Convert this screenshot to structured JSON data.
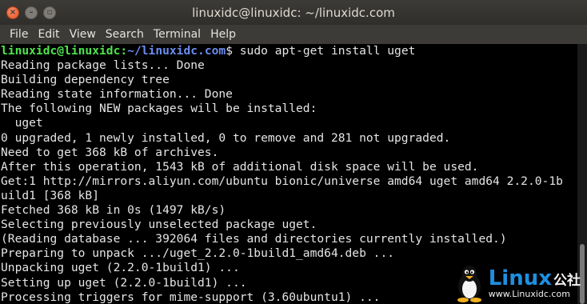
{
  "window": {
    "title": "linuxidc@linuxidc: ~/linuxidc.com",
    "close_glyph": "×",
    "min_glyph": "–",
    "max_glyph": "▫"
  },
  "menu": {
    "items": [
      "File",
      "Edit",
      "View",
      "Search",
      "Terminal",
      "Help"
    ]
  },
  "terminal": {
    "prompt_user": "linuxidc@linuxidc",
    "prompt_sep": ":",
    "prompt_path": "~/linuxidc.com",
    "prompt_end": "$ ",
    "command": "sudo apt-get install uget",
    "output": [
      "Reading package lists... Done",
      "Building dependency tree",
      "Reading state information... Done",
      "The following NEW packages will be installed:",
      "  uget",
      "0 upgraded, 1 newly installed, 0 to remove and 281 not upgraded.",
      "Need to get 368 kB of archives.",
      "After this operation, 1543 kB of additional disk space will be used.",
      "Get:1 http://mirrors.aliyun.com/ubuntu bionic/universe amd64 uget amd64 2.2.0-1b",
      "uild1 [368 kB]",
      "Fetched 368 kB in 0s (1497 kB/s)",
      "Selecting previously unselected package uget.",
      "(Reading database ... 392064 files and directories currently installed.)",
      "Preparing to unpack .../uget_2.2.0-1build1_amd64.deb ...",
      "Unpacking uget (2.2.0-1build1) ...",
      "Setting up uget (2.2.0-1build1) ...",
      "Processing triggers for mime-support (3.60ubuntu1) ..."
    ]
  },
  "watermark": {
    "brand": "Linux",
    "brand_cn": "公社",
    "url": "www.Linuxidc.com"
  },
  "colors": {
    "prompt_user": "#4ee44e",
    "prompt_path": "#6b8cf0",
    "close_button": "#e9541f",
    "watermark_brand": "#1e8fe0"
  }
}
